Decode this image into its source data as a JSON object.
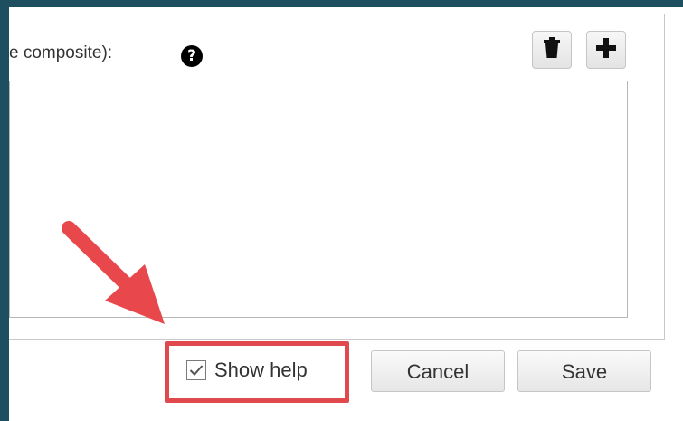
{
  "dialog": {
    "field_label": "e composite):",
    "help_icon_glyph": "?"
  },
  "toolbar": {
    "delete_icon": "trash-icon",
    "add_icon": "plus-icon"
  },
  "textarea": {
    "value": ""
  },
  "footer": {
    "show_help_label": "Show help",
    "show_help_checked": true,
    "cancel_label": "Cancel",
    "save_label": "Save"
  },
  "annotation": {
    "arrow_color": "#e8484c",
    "highlight_color": "#e0494d"
  },
  "colors": {
    "frame": "#1d4f61"
  }
}
